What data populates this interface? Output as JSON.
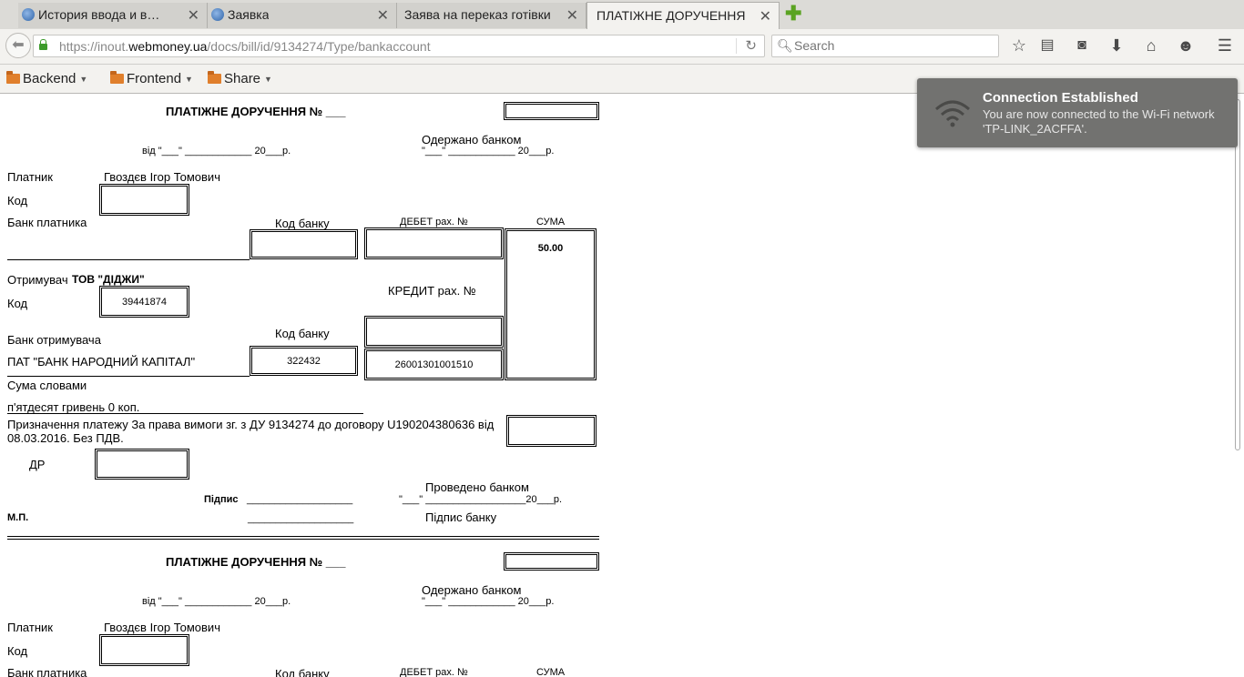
{
  "tabs": [
    {
      "title": "История ввода и в…",
      "favicon": "webmoney-globe-icon"
    },
    {
      "title": "Заявка",
      "favicon": "webmoney-globe-icon"
    },
    {
      "title": "Заява на переказ готівки",
      "favicon": ""
    },
    {
      "title": "ПЛАТІЖНЕ ДОРУЧЕННЯ",
      "favicon": "",
      "active": true
    }
  ],
  "url": {
    "prefix": "https://inout.",
    "domain": "webmoney.ua",
    "path": "/docs/bill/id/9134274/Type/bankaccount"
  },
  "search": {
    "placeholder": "Search"
  },
  "bookmarks": [
    "Backend",
    "Frontend",
    "Share"
  ],
  "form1": {
    "title": "ПЛАТІЖНЕ ДОРУЧЕННЯ № ___",
    "date_line": "від \"___\" ____________ 20___р.",
    "received_label": "Одержано банком",
    "received_date": "\"___\" ____________ 20___р.",
    "payer_label": "Платник",
    "payer_name": "Гвоздєв Ігор Томович",
    "code_label": "Код",
    "payer_bank_label": "Банк платника",
    "bank_code_label": "Код банку",
    "debit_label": "ДЕБЕТ рах. №",
    "sum_label": "СУМА",
    "sum_value": "50.00",
    "recipient_label": "Отримувач",
    "recipient_name": "ТОВ \"ДІДЖИ\"",
    "recipient_code": "39441874",
    "credit_label": "КРЕДИТ рах. №",
    "recipient_bank_label": "Банк отримувача",
    "recipient_bank_code_label": "Код банку",
    "recipient_bank_name": "ПАТ \"БАНК НАРОДНИЙ КАПІТАЛ\"",
    "recipient_bank_code": "322432",
    "credit_account": "26001301001510",
    "sum_words_label": "Сума словами",
    "sum_words": "п'ятдесят гривень 0 коп.",
    "purpose_line1": "Призначення платежу За права вимоги зг. з ДУ 9134274 до договору U190204380636 від",
    "purpose_line2": "08.03.2016. Без ПДВ.",
    "dr_label": "ДР",
    "signature_label": "Підпис",
    "signature_line": "___________________",
    "processed_label": "Проведено банком",
    "processed_date": "\"___\" __________________20___р.",
    "mp_label": "М.П.",
    "bank_signature_label": "Підпис банку"
  },
  "notification": {
    "title": "Connection Established",
    "body": "You are now connected to the Wi-Fi network 'TP-LINK_2ACFFA'.",
    "icon": "wifi-icon"
  }
}
